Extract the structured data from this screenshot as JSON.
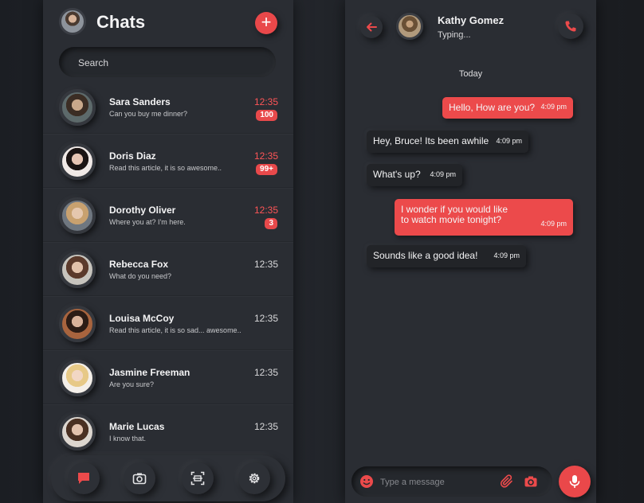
{
  "chats_screen": {
    "title": "Chats",
    "add_icon_glyph": "+",
    "search_placeholder": "Search",
    "chats": [
      {
        "name": "Sara Sanders",
        "preview": "Can you buy me dinner?",
        "time": "12:35",
        "unread": "100",
        "avatar_colors": [
          "#c9a88b",
          "#3b2d24",
          "#5d6a6b"
        ]
      },
      {
        "name": "Doris Diaz",
        "preview": "Read this article, it is so awesome..",
        "time": "12:35",
        "unread": "99+",
        "avatar_colors": [
          "#e7c5b3",
          "#1b1413",
          "#f0e9e6"
        ]
      },
      {
        "name": "Dorothy Oliver",
        "preview": "Where you at? I'm here.",
        "time": "12:35",
        "unread": "3",
        "avatar_colors": [
          "#e5c7ae",
          "#c8a16f",
          "#6f7780"
        ]
      },
      {
        "name": "Rebecca Fox",
        "preview": "What do you need?",
        "time": "12:35",
        "unread": "",
        "avatar_colors": [
          "#e2c2ab",
          "#5b3a2b",
          "#c7c4bd"
        ]
      },
      {
        "name": "Louisa McCoy",
        "preview": "Read this article, it is so sad... awesome..",
        "time": "12:35",
        "unread": "",
        "avatar_colors": [
          "#d9b29a",
          "#2c1c15",
          "#a8643e"
        ]
      },
      {
        "name": "Jasmine Freeman",
        "preview": "Are you sure?",
        "time": "12:35",
        "unread": "",
        "avatar_colors": [
          "#f2d7c4",
          "#e7c987",
          "#f4efe9"
        ]
      },
      {
        "name": "Marie Lucas",
        "preview": "I know that.",
        "time": "12:35",
        "unread": "",
        "avatar_colors": [
          "#e3c2ad",
          "#4a3022",
          "#dcd6cf"
        ]
      }
    ],
    "bottom_nav": [
      {
        "icon": "chat-bubble-icon",
        "active": true
      },
      {
        "icon": "camera-icon",
        "active": false
      },
      {
        "icon": "scan-icon",
        "active": false
      },
      {
        "icon": "settings-gear-icon",
        "active": false
      }
    ]
  },
  "conversation_screen": {
    "contact_name": "Kathy Gomez",
    "contact_status": "Typing...",
    "day_label": "Today",
    "messages": [
      {
        "direction": "out",
        "text": "Hello, How are you?",
        "time": "4:09 pm"
      },
      {
        "direction": "in",
        "text": "Hey, Bruce! Its been awhile",
        "time": "4:09 pm"
      },
      {
        "direction": "in",
        "text": "What's up?",
        "time": "4:09 pm"
      },
      {
        "direction": "out",
        "text": "I wonder if you would like to watch movie tonight?",
        "time": "4:09 pm"
      },
      {
        "direction": "in",
        "text": "Sounds like a good idea!",
        "time": "4:09 pm"
      }
    ],
    "composer_placeholder": "Type a message"
  },
  "colors": {
    "accent": "#ec4a4b",
    "background": "#2a2d33",
    "incoming_bubble": "#222428"
  }
}
